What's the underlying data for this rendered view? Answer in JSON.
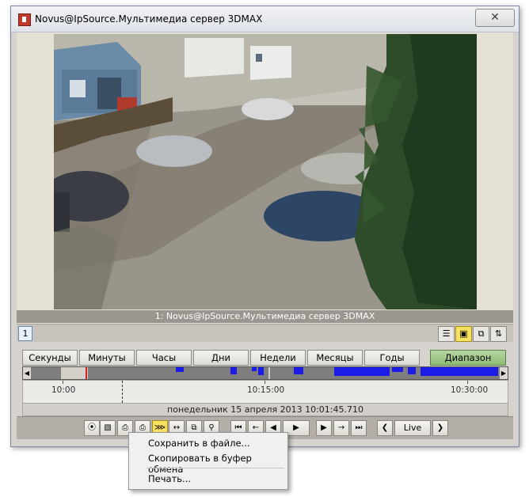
{
  "window": {
    "title": "Novus@IpSource.Мультимедиа сервер 3DMAX",
    "close_glyph": "✕"
  },
  "viewer": {
    "camera_caption": "1: Novus@IpSource.Мультимедиа сервер 3DMAX",
    "camera_tab": "1"
  },
  "view_buttons": [
    "list-view-icon",
    "single-view-icon",
    "multi-view-icon",
    "sort-icon"
  ],
  "timeline": {
    "scales": [
      "Секунды",
      "Минуты",
      "Часы",
      "Дни",
      "Недели",
      "Месяцы",
      "Годы"
    ],
    "range_button": "Диапазон",
    "tick_labels": [
      "10:00",
      "10:15:00",
      "10:30:00"
    ],
    "date_time": "понедельник 15 апреля 2013   10:01:45.710"
  },
  "toolbar": {
    "live_label": "Live",
    "icons": [
      "record-icon",
      "snapshot-icon",
      "export-icon",
      "print-icon",
      "export-menu-icon",
      "fit-range-icon",
      "window-icon",
      "search-icon",
      "go-start-icon",
      "step-back-icon",
      "frame-back-icon",
      "play-icon",
      "frame-forward-icon",
      "step-forward-icon",
      "go-end-icon",
      "prev-icon",
      "next-icon"
    ]
  },
  "context_menu": {
    "items": [
      "Сохранить в файле...",
      "Скопировать в буфер обмена",
      "Печать..."
    ]
  },
  "colors": {
    "recording_segment": "#1c1ce6",
    "active_range": "#8fbb74",
    "active_tool": "#f7e160"
  }
}
